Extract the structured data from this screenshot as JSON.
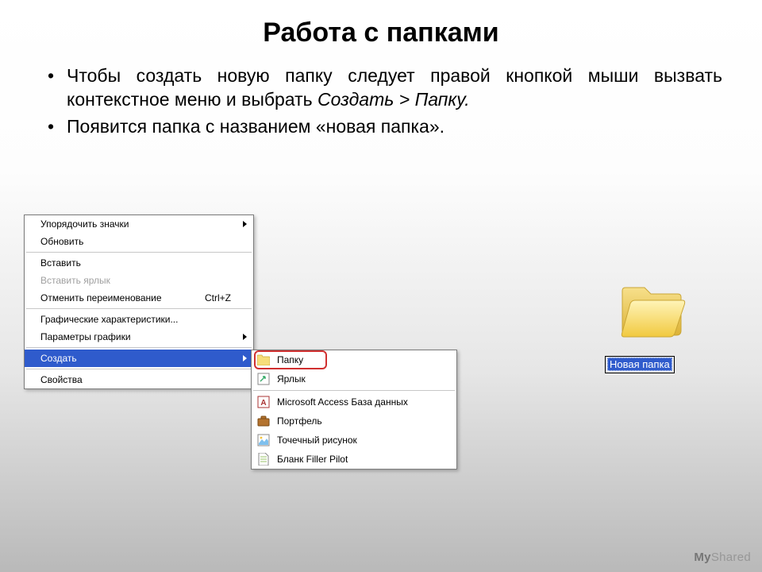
{
  "title": "Работа с папками",
  "bullets": {
    "b1_pre": "Чтобы создать новую папку следует правой кнопкой мыши вызвать контекстное меню и выбрать ",
    "b1_ital": "Создать > Папку.",
    "b2": "Появится папка с названием «новая папка»."
  },
  "context_menu": {
    "arrange": "Упорядочить значки",
    "refresh": "Обновить",
    "paste": "Вставить",
    "paste_shortcut": "Вставить ярлык",
    "undo_rename": "Отменить переименование",
    "undo_shortcut": "Ctrl+Z",
    "gfx_chars": "Графические характеристики...",
    "gfx_params": "Параметры графики",
    "create": "Создать",
    "properties": "Свойства"
  },
  "submenu": {
    "folder": "Папку",
    "shortcut": "Ярлык",
    "access": "Microsoft Access База данных",
    "briefcase": "Портфель",
    "bitmap": "Точечный рисунок",
    "filler": "Бланк Filler Pilot"
  },
  "new_folder_label": "Новая папка",
  "watermark": {
    "a": "My",
    "b": "Shared"
  }
}
